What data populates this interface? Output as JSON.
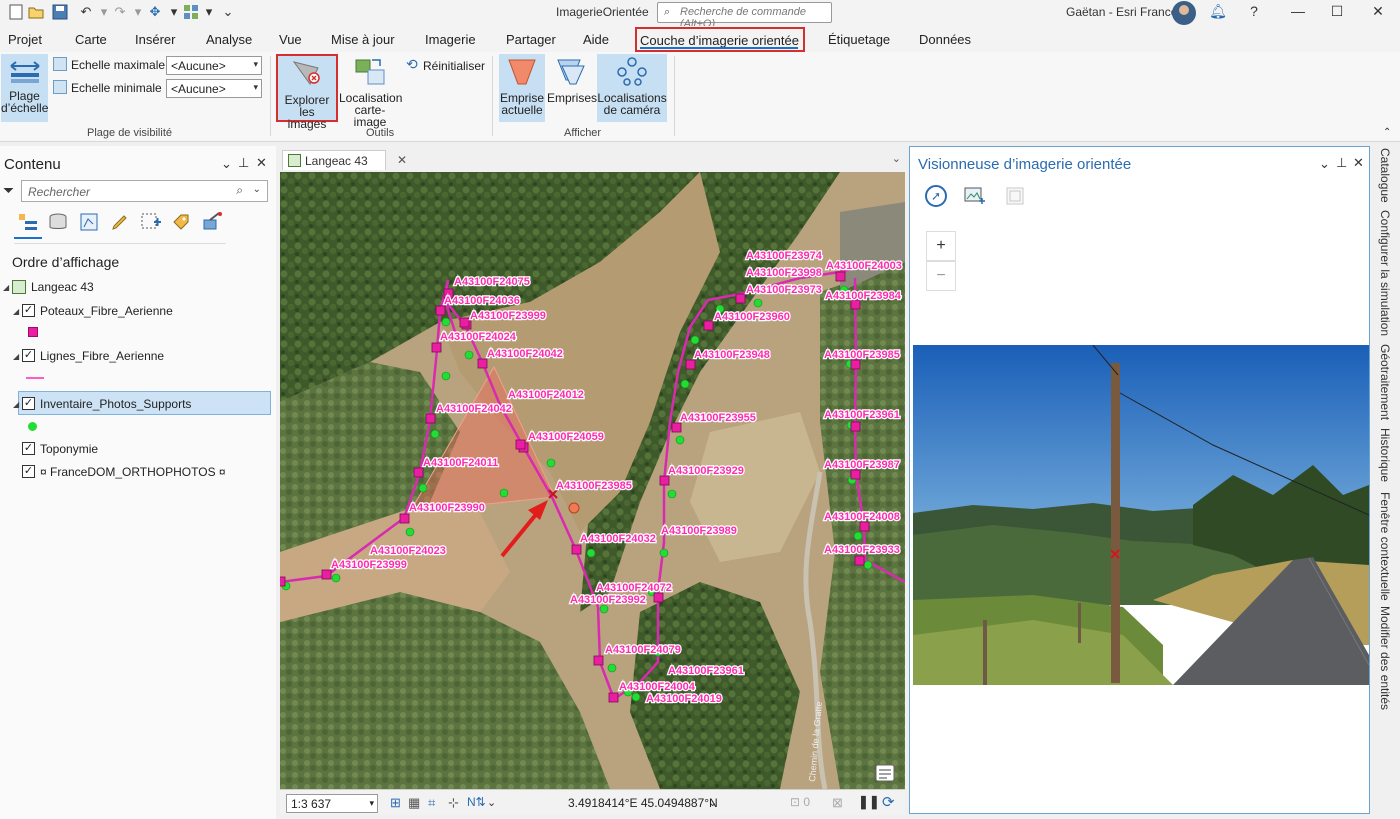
{
  "app": {
    "title": "ImagerieOrientée",
    "command_search_placeholder": "Recherche de commande (Alt+Q)",
    "user": "Gaëtan - Esri France"
  },
  "menu": {
    "tabs": [
      "Projet",
      "Carte",
      "Insérer",
      "Analyse",
      "Vue",
      "Mise à jour",
      "Imagerie",
      "Partager",
      "Aide",
      "Couche d’imagerie orientée",
      "Étiquetage",
      "Données"
    ],
    "active_tab": "Couche d’imagerie orientée"
  },
  "ribbon": {
    "plage_echelle": "Plage d’échelle",
    "echelle_max_label": "Echelle maximale",
    "echelle_min_label": "Echelle minimale",
    "echelle_max_value": "<Aucune>",
    "echelle_min_value": "<Aucune>",
    "group_visibility": "Plage de visibilité",
    "explorer": "Explorer les images",
    "localisation_carte_image": "Localisation carte-image",
    "reinitialiser": "Réinitialiser",
    "group_outils": "Outils",
    "emprise_actuelle": "Emprise actuelle",
    "emprises": "Emprises",
    "localisations_camera": "Localisations de caméra",
    "group_afficher": "Afficher"
  },
  "contents": {
    "title": "Contenu",
    "search_placeholder": "Rechercher",
    "draw_order": "Ordre d’affichage",
    "map_name": "Langeac 43",
    "layers": [
      {
        "name": "Poteaux_Fibre_Aerienne",
        "checked": true
      },
      {
        "name": "Lignes_Fibre_Aerienne",
        "checked": true
      },
      {
        "name": "Inventaire_Photos_Supports",
        "checked": true
      },
      {
        "name": "Toponymie",
        "checked": true
      },
      {
        "name": "¤ FranceDOM_ORTHOPHOTOS ¤",
        "checked": true
      }
    ]
  },
  "map": {
    "tab_title": "Langeac 43",
    "scale": "1:3 637",
    "coordinates": "3.4918414°E 45.0494887°N",
    "labels": [
      "A43100F24075",
      "A43100F24036",
      "A43100F23999",
      "A43100F24024",
      "A43100F24042",
      "A43100F24012",
      "A43100F24042",
      "A43100F24059",
      "A43100F24011",
      "A43100F23985",
      "A43100F23990",
      "A43100F24032",
      "A43100F24023",
      "A43100F23999",
      "A43100F24072",
      "A43100F23992",
      "A43100F24079",
      "A43100F23961",
      "A43100F24004",
      "A43100F24019",
      "A43100F23974",
      "A43100F23998",
      "A43100F24003",
      "A43100F23973",
      "A43100F23984",
      "A43100F23960",
      "A43100F23948",
      "A43100F23985",
      "A43100F23955",
      "A43100F23961",
      "A43100F23929",
      "A43100F23987",
      "A43100F23989",
      "A43100F24008",
      "A43100F23933"
    ],
    "road_label": "Chemin de la Gratte"
  },
  "viewer": {
    "title": "Visionneuse d’imagerie orientée",
    "zoom_in": "+",
    "zoom_out": "−"
  },
  "right_dock": {
    "tabs": [
      "Catalogue",
      "Configurer la simulation",
      "Géotraitement",
      "Historique",
      "Fenêtre contextuelle",
      "Modifier des entités"
    ]
  },
  "colors": {
    "accent": "#1a73c9",
    "highlight_red": "#d62e2e",
    "label_pink": "#ff2bb0",
    "point_green": "#22dd33"
  }
}
